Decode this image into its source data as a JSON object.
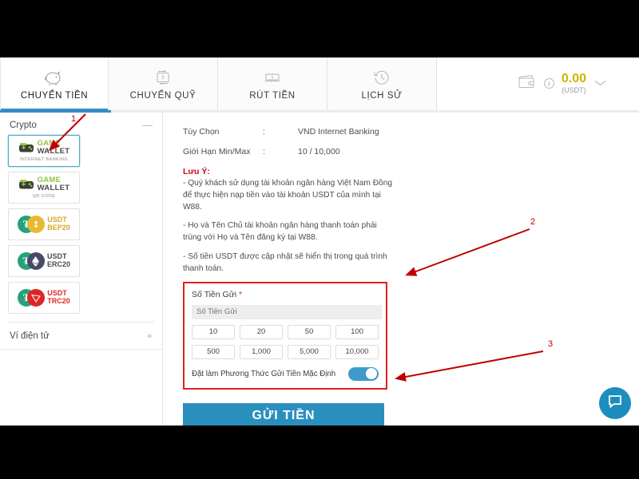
{
  "tabs": [
    {
      "label": "CHUYỂN TIỀN",
      "icon": "piggy-bank-icon",
      "active": true
    },
    {
      "label": "CHUYỂN QUỸ",
      "icon": "transfer-funds-icon",
      "active": false
    },
    {
      "label": "RÚT TIỀN",
      "icon": "withdraw-cash-icon",
      "active": false
    },
    {
      "label": "LỊCH SỬ",
      "icon": "history-clock-icon",
      "active": false
    }
  ],
  "wallet": {
    "icon": "wallet-icon",
    "info_icon": "i",
    "balance": "0.00",
    "currency": "(USDT)",
    "chevron": "chevron-down-icon"
  },
  "sidebar": {
    "crypto_title": "Crypto",
    "collapse_icon": "—",
    "methods": [
      {
        "name": "game-wallet-internet-banking",
        "brand_top": "GAME",
        "brand_bottom": "WALLET",
        "sub": "INTERNET BANKING",
        "selected": true
      },
      {
        "name": "game-wallet-qr-code",
        "brand_top": "GAME",
        "brand_bottom": "WALLET",
        "sub": "QR CODE",
        "selected": false
      },
      {
        "name": "usdt-bep20",
        "line1": "USDT",
        "line2": "BEP20",
        "color": "#d9a82a",
        "selected": false
      },
      {
        "name": "usdt-erc20",
        "line1": "USDT",
        "line2": "ERC20",
        "color": "#4a4a4a",
        "selected": false
      },
      {
        "name": "usdt-trc20",
        "line1": "USDT",
        "line2": "TRC20",
        "color": "#e02424",
        "selected": false
      }
    ],
    "ewallet_title": "Ví điện tử",
    "expand_icon": "+"
  },
  "main": {
    "rows": [
      {
        "key": "Tùy Chọn",
        "colon": ":",
        "value": "VND Internet Banking"
      },
      {
        "key": "Giới Hạn Min/Max",
        "colon": ":",
        "value": "10 / 10,000"
      }
    ],
    "note_title": "Lưu Ý:",
    "notes": [
      "- Quý khách sử dụng tài khoản ngân hàng Việt Nam Đồng để thực hiện nạp tiền vào tài khoản USDT của mình tại W88.",
      "- Họ và Tên Chủ tài khoản ngân hàng thanh toán phải trùng với Họ và Tên đăng ký tại W88.",
      "- Số tiền USDT được cập nhật sẽ hiển thị trong quá trình thanh toán."
    ],
    "deposit": {
      "label": "Số Tiền Gửi",
      "required_mark": "*",
      "placeholder": "Số Tiền Gửi",
      "value": "",
      "chips": [
        "10",
        "20",
        "50",
        "100",
        "500",
        "1,000",
        "5,000",
        "10,000"
      ],
      "toggle_label": "Đặt làm Phương Thức Gửi Tiền Mặc Định",
      "toggle_on": true
    },
    "submit_label": "GỬI TIỀN"
  },
  "chat": {
    "icon": "chat-bubble-icon"
  },
  "annotations": [
    {
      "number": "1"
    },
    {
      "number": "2"
    },
    {
      "number": "3"
    }
  ],
  "colors": {
    "accent_blue": "#2a8fbd",
    "toggle_blue": "#3d9bc9",
    "annotation_red": "#c00000",
    "note_red": "#d0021b",
    "balance_gold": "#d2b100",
    "tether_green": "#26a17b"
  }
}
